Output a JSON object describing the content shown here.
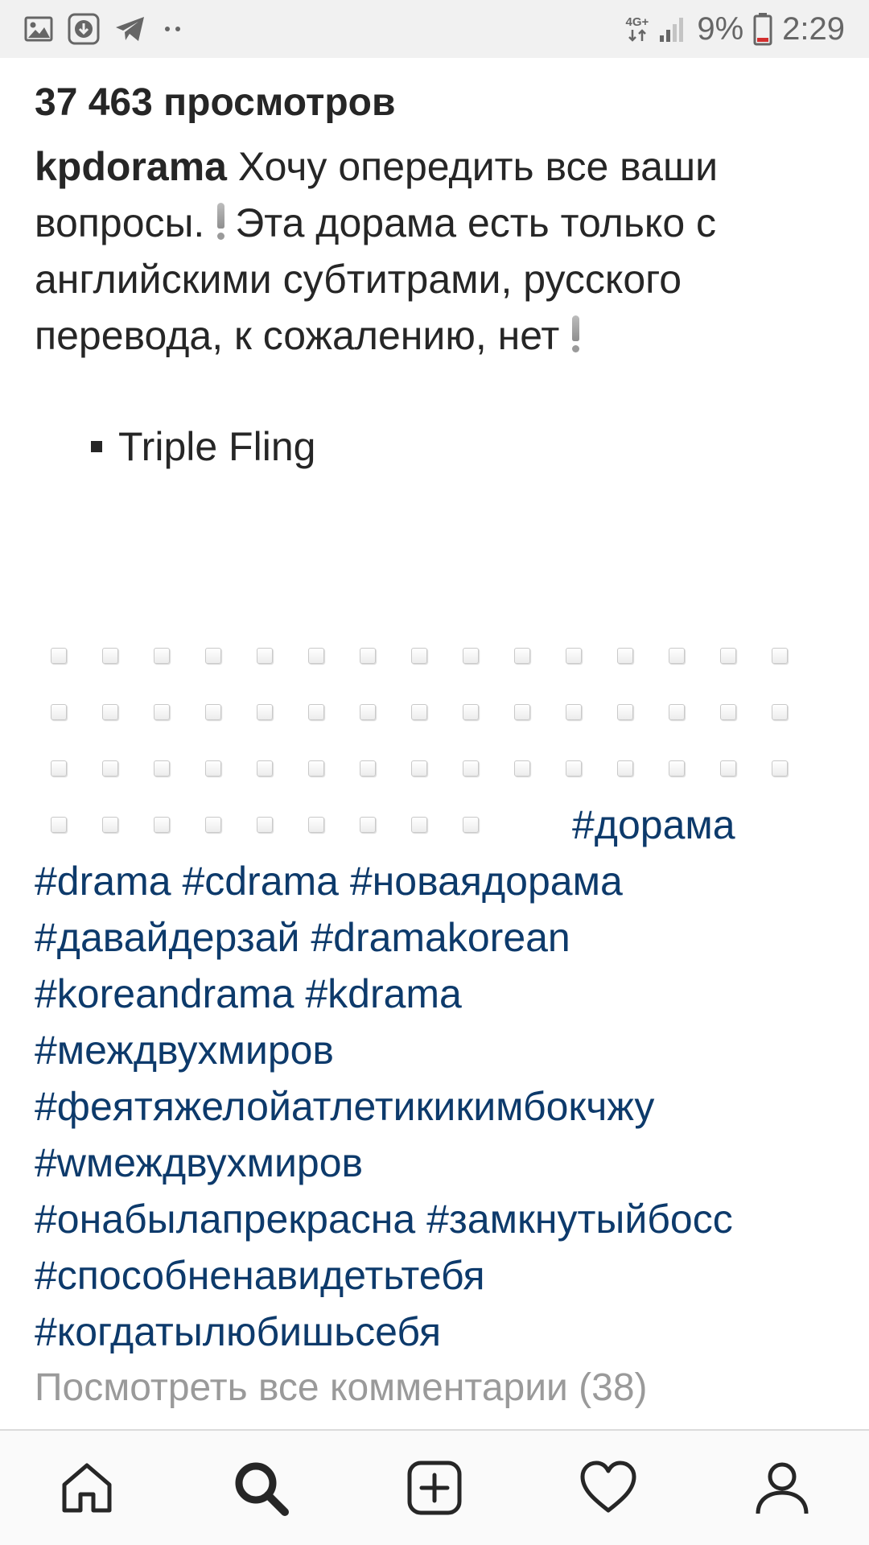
{
  "status_bar": {
    "network": "4G+",
    "battery_percent": "9%",
    "time": "2:29",
    "notification_icons": [
      "gallery-icon",
      "download-icon",
      "telegram-icon",
      "more-notifications-icon"
    ],
    "status_icons": [
      "network-type-icon",
      "signal-icon",
      "battery-icon"
    ]
  },
  "post": {
    "views": "37 463 просмотров",
    "username": "kpdorama",
    "caption_part1": "Хочу опередить все ваши вопросы.",
    "caption_part2": "Эта дорама есть только с английскими субтитрами, русского перевода, к сожалению, нет",
    "list_item": "Triple Fling",
    "box_rows": [
      15,
      15,
      15,
      9
    ],
    "first_hashtag": "#дорама",
    "hashtag_lines": [
      [
        "#drama",
        "#cdrama",
        "#новаядорама"
      ],
      [
        "#давайдерзай",
        "#dramakorean"
      ],
      [
        "#koreandrama",
        "#kdrama"
      ],
      [
        "#междвухмиров"
      ],
      [
        "#феятяжелойатлетикикимбокчжу"
      ],
      [
        "#wмеждвухмиров"
      ],
      [
        "#онабылапрекрасна",
        "#замкнутыйбосс"
      ],
      [
        "#способненавидетьтебя"
      ],
      [
        "#когдатылюбишьсебя"
      ]
    ],
    "view_comments": "Посмотреть все комментарии (38)"
  },
  "bottom_nav": {
    "items": [
      "home-icon",
      "search-icon",
      "new-post-icon",
      "activity-icon",
      "profile-icon"
    ],
    "active": "search-icon"
  },
  "colors": {
    "text": "#262626",
    "hashtag": "#0d3a6b",
    "muted": "#9a9a9a",
    "status_bar_bg": "#f1f1f1",
    "nav_bg": "#fafafa"
  }
}
